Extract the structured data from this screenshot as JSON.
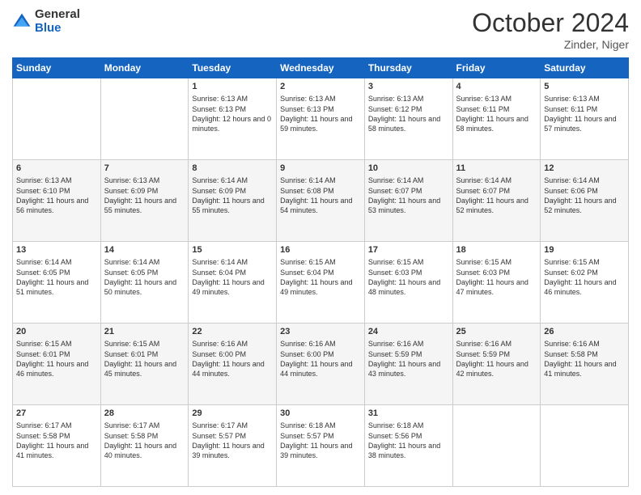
{
  "header": {
    "logo_line1": "General",
    "logo_line2": "Blue",
    "month": "October 2024",
    "location": "Zinder, Niger"
  },
  "days_of_week": [
    "Sunday",
    "Monday",
    "Tuesday",
    "Wednesday",
    "Thursday",
    "Friday",
    "Saturday"
  ],
  "weeks": [
    [
      {
        "day": "",
        "content": ""
      },
      {
        "day": "",
        "content": ""
      },
      {
        "day": "1",
        "content": "Sunrise: 6:13 AM\nSunset: 6:13 PM\nDaylight: 12 hours and 0 minutes."
      },
      {
        "day": "2",
        "content": "Sunrise: 6:13 AM\nSunset: 6:13 PM\nDaylight: 11 hours and 59 minutes."
      },
      {
        "day": "3",
        "content": "Sunrise: 6:13 AM\nSunset: 6:12 PM\nDaylight: 11 hours and 58 minutes."
      },
      {
        "day": "4",
        "content": "Sunrise: 6:13 AM\nSunset: 6:11 PM\nDaylight: 11 hours and 58 minutes."
      },
      {
        "day": "5",
        "content": "Sunrise: 6:13 AM\nSunset: 6:11 PM\nDaylight: 11 hours and 57 minutes."
      }
    ],
    [
      {
        "day": "6",
        "content": "Sunrise: 6:13 AM\nSunset: 6:10 PM\nDaylight: 11 hours and 56 minutes."
      },
      {
        "day": "7",
        "content": "Sunrise: 6:13 AM\nSunset: 6:09 PM\nDaylight: 11 hours and 55 minutes."
      },
      {
        "day": "8",
        "content": "Sunrise: 6:14 AM\nSunset: 6:09 PM\nDaylight: 11 hours and 55 minutes."
      },
      {
        "day": "9",
        "content": "Sunrise: 6:14 AM\nSunset: 6:08 PM\nDaylight: 11 hours and 54 minutes."
      },
      {
        "day": "10",
        "content": "Sunrise: 6:14 AM\nSunset: 6:07 PM\nDaylight: 11 hours and 53 minutes."
      },
      {
        "day": "11",
        "content": "Sunrise: 6:14 AM\nSunset: 6:07 PM\nDaylight: 11 hours and 52 minutes."
      },
      {
        "day": "12",
        "content": "Sunrise: 6:14 AM\nSunset: 6:06 PM\nDaylight: 11 hours and 52 minutes."
      }
    ],
    [
      {
        "day": "13",
        "content": "Sunrise: 6:14 AM\nSunset: 6:05 PM\nDaylight: 11 hours and 51 minutes."
      },
      {
        "day": "14",
        "content": "Sunrise: 6:14 AM\nSunset: 6:05 PM\nDaylight: 11 hours and 50 minutes."
      },
      {
        "day": "15",
        "content": "Sunrise: 6:14 AM\nSunset: 6:04 PM\nDaylight: 11 hours and 49 minutes."
      },
      {
        "day": "16",
        "content": "Sunrise: 6:15 AM\nSunset: 6:04 PM\nDaylight: 11 hours and 49 minutes."
      },
      {
        "day": "17",
        "content": "Sunrise: 6:15 AM\nSunset: 6:03 PM\nDaylight: 11 hours and 48 minutes."
      },
      {
        "day": "18",
        "content": "Sunrise: 6:15 AM\nSunset: 6:03 PM\nDaylight: 11 hours and 47 minutes."
      },
      {
        "day": "19",
        "content": "Sunrise: 6:15 AM\nSunset: 6:02 PM\nDaylight: 11 hours and 46 minutes."
      }
    ],
    [
      {
        "day": "20",
        "content": "Sunrise: 6:15 AM\nSunset: 6:01 PM\nDaylight: 11 hours and 46 minutes."
      },
      {
        "day": "21",
        "content": "Sunrise: 6:15 AM\nSunset: 6:01 PM\nDaylight: 11 hours and 45 minutes."
      },
      {
        "day": "22",
        "content": "Sunrise: 6:16 AM\nSunset: 6:00 PM\nDaylight: 11 hours and 44 minutes."
      },
      {
        "day": "23",
        "content": "Sunrise: 6:16 AM\nSunset: 6:00 PM\nDaylight: 11 hours and 44 minutes."
      },
      {
        "day": "24",
        "content": "Sunrise: 6:16 AM\nSunset: 5:59 PM\nDaylight: 11 hours and 43 minutes."
      },
      {
        "day": "25",
        "content": "Sunrise: 6:16 AM\nSunset: 5:59 PM\nDaylight: 11 hours and 42 minutes."
      },
      {
        "day": "26",
        "content": "Sunrise: 6:16 AM\nSunset: 5:58 PM\nDaylight: 11 hours and 41 minutes."
      }
    ],
    [
      {
        "day": "27",
        "content": "Sunrise: 6:17 AM\nSunset: 5:58 PM\nDaylight: 11 hours and 41 minutes."
      },
      {
        "day": "28",
        "content": "Sunrise: 6:17 AM\nSunset: 5:58 PM\nDaylight: 11 hours and 40 minutes."
      },
      {
        "day": "29",
        "content": "Sunrise: 6:17 AM\nSunset: 5:57 PM\nDaylight: 11 hours and 39 minutes."
      },
      {
        "day": "30",
        "content": "Sunrise: 6:18 AM\nSunset: 5:57 PM\nDaylight: 11 hours and 39 minutes."
      },
      {
        "day": "31",
        "content": "Sunrise: 6:18 AM\nSunset: 5:56 PM\nDaylight: 11 hours and 38 minutes."
      },
      {
        "day": "",
        "content": ""
      },
      {
        "day": "",
        "content": ""
      }
    ]
  ]
}
